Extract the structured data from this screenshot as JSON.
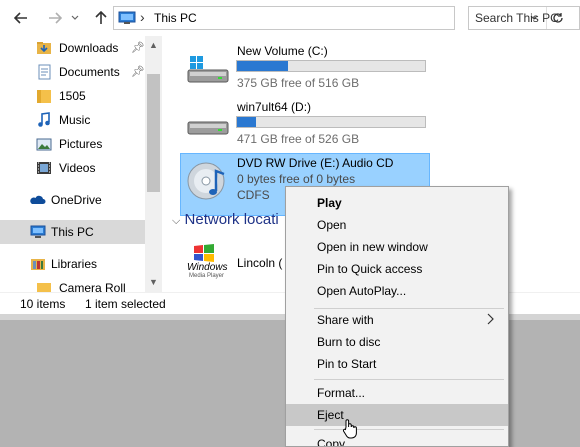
{
  "address_bar": {
    "path_separator": "›",
    "location": "This PC",
    "search_placeholder": "Search This PC"
  },
  "sidebar": {
    "items": [
      {
        "label": "Downloads",
        "icon": "downloads-folder-icon",
        "pinned": true
      },
      {
        "label": "Documents",
        "icon": "documents-icon",
        "pinned": true
      },
      {
        "label": "1505",
        "icon": "folder-icon",
        "pinned": false
      },
      {
        "label": "Music",
        "icon": "music-icon",
        "pinned": false
      },
      {
        "label": "Pictures",
        "icon": "pictures-icon",
        "pinned": false
      },
      {
        "label": "Videos",
        "icon": "videos-icon",
        "pinned": false
      },
      {
        "label": "OneDrive",
        "icon": "onedrive-icon",
        "pinned": false
      },
      {
        "label": "This PC",
        "icon": "this-pc-icon",
        "pinned": false
      },
      {
        "label": "Libraries",
        "icon": "libraries-icon",
        "pinned": false
      },
      {
        "label": "Camera Roll",
        "icon": "camera-roll-icon",
        "pinned": false
      }
    ]
  },
  "drives": [
    {
      "name": "New Volume (C:)",
      "free": "375 GB free of 516 GB",
      "used_fraction": 0.27
    },
    {
      "name": "win7ult64 (D:)",
      "free": "471 GB free of 526 GB",
      "used_fraction": 0.1
    },
    {
      "name": "DVD RW Drive (E:) Audio CD",
      "free": "0 bytes free of 0 bytes",
      "filesystem": "CDFS"
    }
  ],
  "network_group": {
    "heading": "Network locati",
    "items": [
      {
        "name": "Lincoln (",
        "logo_text": "Windows",
        "logo_subtext": "Media Player"
      }
    ]
  },
  "status_bar": {
    "item_count": "10 items",
    "selected": "1 item selected"
  },
  "context_menu": {
    "items": [
      {
        "label": "Play",
        "bold": true
      },
      {
        "label": "Open"
      },
      {
        "label": "Open in new window"
      },
      {
        "label": "Pin to Quick access"
      },
      {
        "label": "Open AutoPlay..."
      },
      {
        "label": "Share with",
        "submenu": true
      },
      {
        "label": "Burn to disc"
      },
      {
        "label": "Pin to Start"
      },
      {
        "label": "Format..."
      },
      {
        "label": "Eject",
        "hovered": true
      },
      {
        "label": "Copy"
      }
    ]
  },
  "colors": {
    "selection": "#99d1ff",
    "drive_bar_fill": "#2a78d1",
    "menu_hover": "#c8c8c8"
  }
}
